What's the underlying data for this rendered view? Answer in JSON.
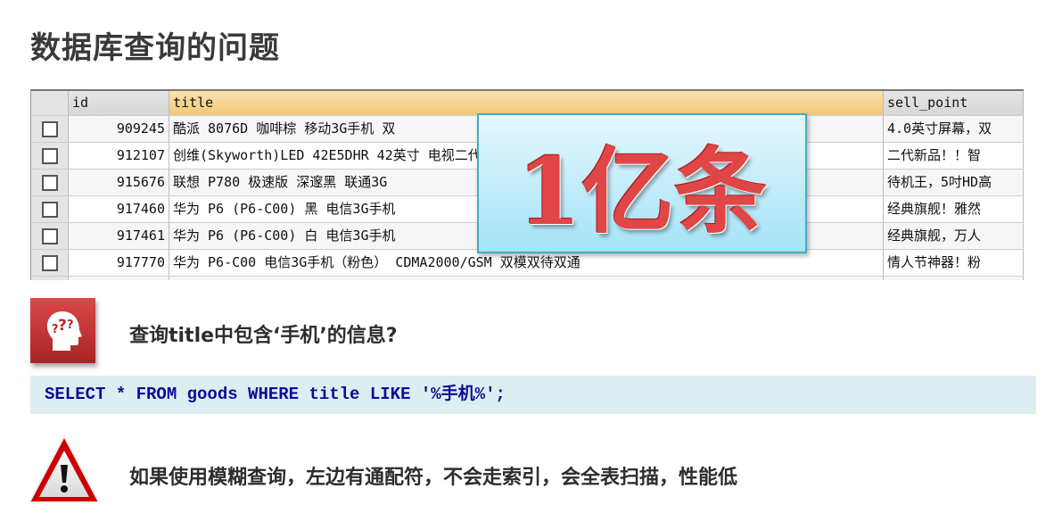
{
  "title": "数据库查询的问题",
  "table": {
    "columns": [
      "",
      "id",
      "title",
      "sell_point"
    ],
    "rows": [
      {
        "id": "909245",
        "title": "酷派 8076D 咖啡棕 移动3G手机 双",
        "sell_point": "4.0英寸屏幕，双"
      },
      {
        "id": "912107",
        "title": "创维(Skyworth)LED 42E5DHR 42英寸                        电视二代:",
        "sell_point": "二代新品！！智"
      },
      {
        "id": "915676",
        "title": "联想 P780 极速版 深邃黑 联通3G",
        "sell_point": "待机王，5吋HD高"
      },
      {
        "id": "917460",
        "title": "华为 P6 (P6-C00) 黑 电信3G手机",
        "sell_point": "经典旗舰！雅然"
      },
      {
        "id": "917461",
        "title": "华为 P6 (P6-C00) 白 电信3G手机",
        "sell_point": "经典旗舰，万人"
      },
      {
        "id": "917770",
        "title": "华为 P6-C00 电信3G手机（粉色） CDMA2000/GSM 双模双待双通",
        "sell_point": "情人节神器！粉"
      },
      {
        "id": "",
        "title": "",
        "sell_point": ""
      }
    ]
  },
  "overlay": "1亿条",
  "question": {
    "icon": "thinking-head-icon",
    "text": "查询title中包含‘手机’的信息?"
  },
  "sql": "SELECT * FROM goods WHERE title LIKE '%手机%';",
  "warning": {
    "icon": "warning-triangle-icon",
    "text": "如果使用模糊查询，左边有通配符，不会走索引，会全表扫描，性能低"
  },
  "colors": {
    "accent_red": "#c83232",
    "sql_bg": "#ddeef3",
    "sql_text": "#0b0b98"
  }
}
